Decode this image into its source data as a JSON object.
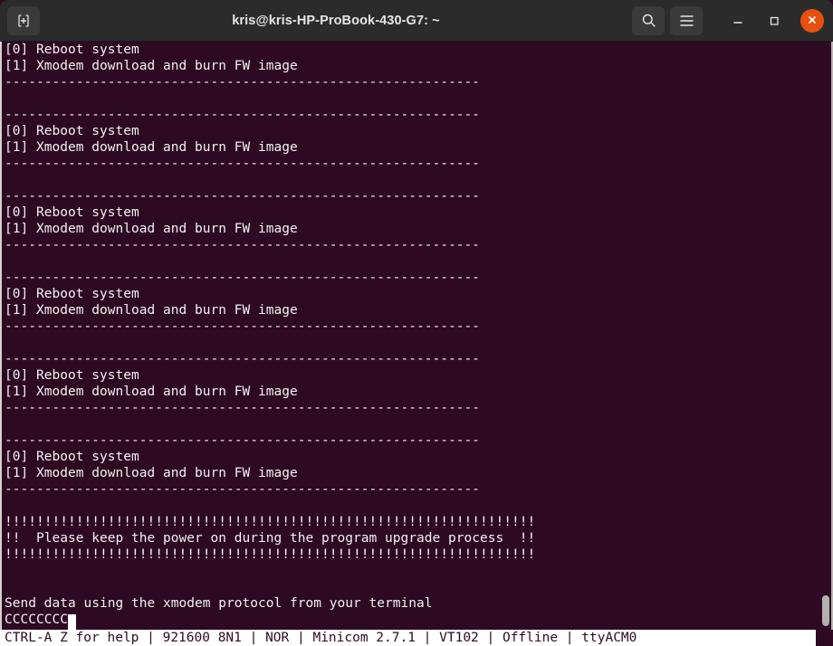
{
  "window": {
    "title": "kris@kris-HP-ProBook-430-G7: ~",
    "background_color": "#2D0922",
    "titlebar_color": "#2b2b2b",
    "text_color": "#f2f2f2",
    "close_color": "#e8500f"
  },
  "titlebar": {
    "new_tab_icon": "new-tab-icon",
    "search_icon": "search-icon",
    "menu_icon": "hamburger-menu-icon",
    "minimize_icon": "minimize-icon",
    "maximize_icon": "maximize-icon",
    "close_icon": "close-icon"
  },
  "terminal": {
    "separator": "------------------------------------------------------------",
    "bang_line": "!!!!!!!!!!!!!!!!!!!!!!!!!!!!!!!!!!!!!!!!!!!!!!!!!!!!!!!!!!!!!!!!!!!",
    "menu_option_0": "[0] Reboot system",
    "menu_option_1": "[1] Xmodem download and burn FW image",
    "warning_text": "!!  Please keep the power on during the program upgrade process  !!",
    "send_prompt": "Send data using the xmodem protocol from your terminal",
    "xmodem_chars": "CCCCCCCC",
    "lines": [
      "[0] Reboot system",
      "[1] Xmodem download and burn FW image",
      "------------------------------------------------------------",
      "",
      "------------------------------------------------------------",
      "[0] Reboot system",
      "[1] Xmodem download and burn FW image",
      "------------------------------------------------------------",
      "",
      "------------------------------------------------------------",
      "[0] Reboot system",
      "[1] Xmodem download and burn FW image",
      "------------------------------------------------------------",
      "",
      "------------------------------------------------------------",
      "[0] Reboot system",
      "[1] Xmodem download and burn FW image",
      "------------------------------------------------------------",
      "",
      "------------------------------------------------------------",
      "[0] Reboot system",
      "[1] Xmodem download and burn FW image",
      "------------------------------------------------------------",
      "",
      "------------------------------------------------------------",
      "[0] Reboot system",
      "[1] Xmodem download and burn FW image",
      "------------------------------------------------------------",
      "",
      "!!!!!!!!!!!!!!!!!!!!!!!!!!!!!!!!!!!!!!!!!!!!!!!!!!!!!!!!!!!!!!!!!!!",
      "!!  Please keep the power on during the program upgrade process  !!",
      "!!!!!!!!!!!!!!!!!!!!!!!!!!!!!!!!!!!!!!!!!!!!!!!!!!!!!!!!!!!!!!!!!!!",
      "",
      "",
      "Send data using the xmodem protocol from your terminal"
    ],
    "cursor_line": "CCCCCCCC"
  },
  "statusbar": {
    "text": "CTRL-A Z for help | 921600 8N1 | NOR | Minicom 2.7.1 | VT102 | Offline | ttyACM0",
    "help_hint": "CTRL-A Z for help",
    "baud": "921600 8N1",
    "flow": "NOR",
    "program": "Minicom 2.7.1",
    "emulation": "VT102",
    "connection": "Offline",
    "device": "ttyACM0"
  }
}
